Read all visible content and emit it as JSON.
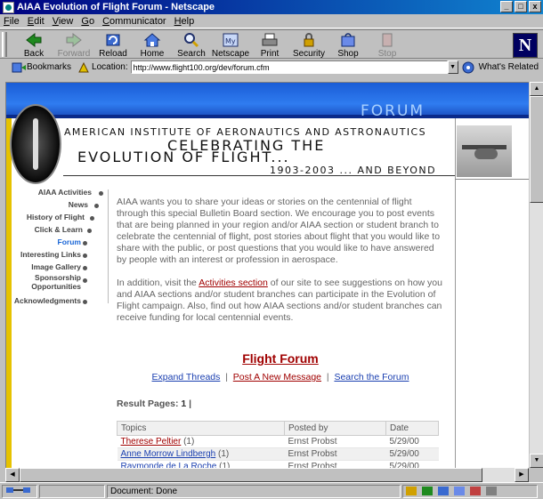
{
  "window": {
    "title": "AIAA Evolution of Flight Forum - Netscape",
    "btn_min": "_",
    "btn_max": "□",
    "btn_close": "x"
  },
  "menu": [
    "File",
    "Edit",
    "View",
    "Go",
    "Communicator",
    "Help"
  ],
  "toolbar": [
    {
      "label": "Back",
      "icon": "back-arrow-icon",
      "enabled": true
    },
    {
      "label": "Forward",
      "icon": "forward-arrow-icon",
      "enabled": false
    },
    {
      "label": "Reload",
      "icon": "reload-icon",
      "enabled": true
    },
    {
      "label": "Home",
      "icon": "home-icon",
      "enabled": true
    },
    {
      "label": "Search",
      "icon": "search-icon",
      "enabled": true
    },
    {
      "label": "Netscape",
      "icon": "netscape-icon",
      "enabled": true
    },
    {
      "label": "Print",
      "icon": "print-icon",
      "enabled": true
    },
    {
      "label": "Security",
      "icon": "lock-icon",
      "enabled": true
    },
    {
      "label": "Shop",
      "icon": "shop-icon",
      "enabled": true
    },
    {
      "label": "Stop",
      "icon": "stop-icon",
      "enabled": false
    }
  ],
  "brand_logo": "N",
  "location": {
    "bookmarks_label": "Bookmarks",
    "location_label": "Location:",
    "url": "http://www.flight100.org/dev/forum.cfm",
    "related_label": "What's Related"
  },
  "page": {
    "banner_word": "FORUM",
    "org_name": "AMERICAN INSTITUTE OF AERONAUTICS AND ASTRONAUTICS",
    "headline_line1": "CELEBRATING THE",
    "headline_line2": "EVOLUTION OF FLIGHT...",
    "years": "1903-2003 ... AND BEYOND",
    "nav": [
      {
        "label": "AIAA Activities",
        "active": false
      },
      {
        "label": "News",
        "active": false
      },
      {
        "label": "History of Flight",
        "active": false
      },
      {
        "label": "Click & Learn",
        "active": false
      },
      {
        "label": "Forum",
        "active": true
      },
      {
        "label": "Interesting Links",
        "active": false
      },
      {
        "label": "Image Gallery",
        "active": false
      },
      {
        "label": "Sponsorship Opportunities",
        "active": false
      },
      {
        "label": "Acknowledgments",
        "active": false
      }
    ],
    "para1": "AIAA wants you to share your ideas or stories on the centennial of flight through this special Bulletin Board section. We encourage you to post events that are being planned in your region and/or AIAA section or student branch to celebrate the centennial of flight, post stories about flight that you would like to share with the public, or post questions that you would like to have answered by people with an interest or profession in aerospace.",
    "para2_before": "In addition, visit the ",
    "para2_link": "Activities section",
    "para2_after": " of our site to see suggestions on how you and AIAA sections and/or student branches can participate in the Evolution of Flight campaign. Also, find out how AIAA sections and/or student branches can receive funding for local centennial events.",
    "forum_title": "Flight Forum",
    "link_expand": "Expand Threads",
    "link_post": "Post A New Message",
    "link_search": "Search the Forum",
    "link_sep": "|",
    "result_label": "Result Pages:",
    "result_page": "1",
    "result_sep": "|",
    "table_headers": [
      "Topics",
      "Posted by",
      "Date"
    ],
    "table_rows": [
      {
        "topic": "Therese Peltier",
        "count": "(1)",
        "poster": "Ernst Probst",
        "date": "5/29/00",
        "color": "#a00000"
      },
      {
        "topic": "Anne Morrow Lindbergh",
        "count": "(1)",
        "poster": "Ernst Probst",
        "date": "5/29/00",
        "color": "#1a3fb0"
      },
      {
        "topic": "Raymonde de La Roche",
        "count": "(1)",
        "poster": "Ernst Probst",
        "date": "5/29/00",
        "color": "#1a3fb0"
      }
    ]
  },
  "status": {
    "text": "Document: Done"
  },
  "colors": {
    "banner_blue": "#2f7cf0",
    "link_red": "#a00000",
    "nav_active": "#1a66d6"
  }
}
